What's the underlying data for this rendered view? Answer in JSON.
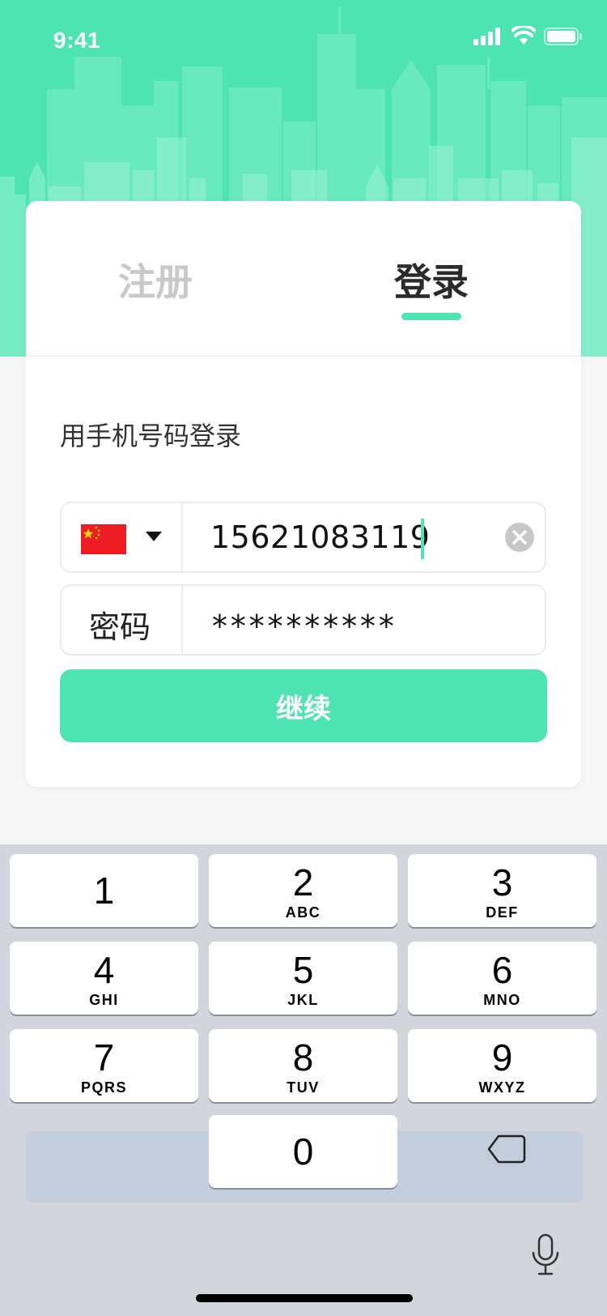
{
  "status_bar": {
    "time": "9:41"
  },
  "tabs": {
    "register": "注册",
    "login": "登录"
  },
  "form": {
    "subtitle": "用手机号码登录",
    "phone_value": "15621083119",
    "password_label": "密码",
    "password_value": "**********",
    "continue_label": "继续"
  },
  "keyboard": {
    "keys": [
      {
        "digit": "1",
        "letters": ""
      },
      {
        "digit": "2",
        "letters": "ABC"
      },
      {
        "digit": "3",
        "letters": "DEF"
      },
      {
        "digit": "4",
        "letters": "GHI"
      },
      {
        "digit": "5",
        "letters": "JKL"
      },
      {
        "digit": "6",
        "letters": "MNO"
      },
      {
        "digit": "7",
        "letters": "PQRS"
      },
      {
        "digit": "8",
        "letters": "TUV"
      },
      {
        "digit": "9",
        "letters": "WXYZ"
      },
      {
        "digit": "0",
        "letters": ""
      }
    ]
  },
  "icons": {
    "signal": "signal-icon",
    "wifi": "wifi-icon",
    "battery": "battery-icon",
    "flag": "china-flag-icon",
    "dropdown": "caret-down-icon",
    "clear": "clear-icon",
    "backspace": "backspace-icon",
    "microphone": "microphone-icon"
  },
  "colors": {
    "accent": "#4ee4b1",
    "tab_inactive": "#c9c9c9",
    "tab_active": "#2a2a2a",
    "keyboard_bg": "#d2d5db"
  }
}
